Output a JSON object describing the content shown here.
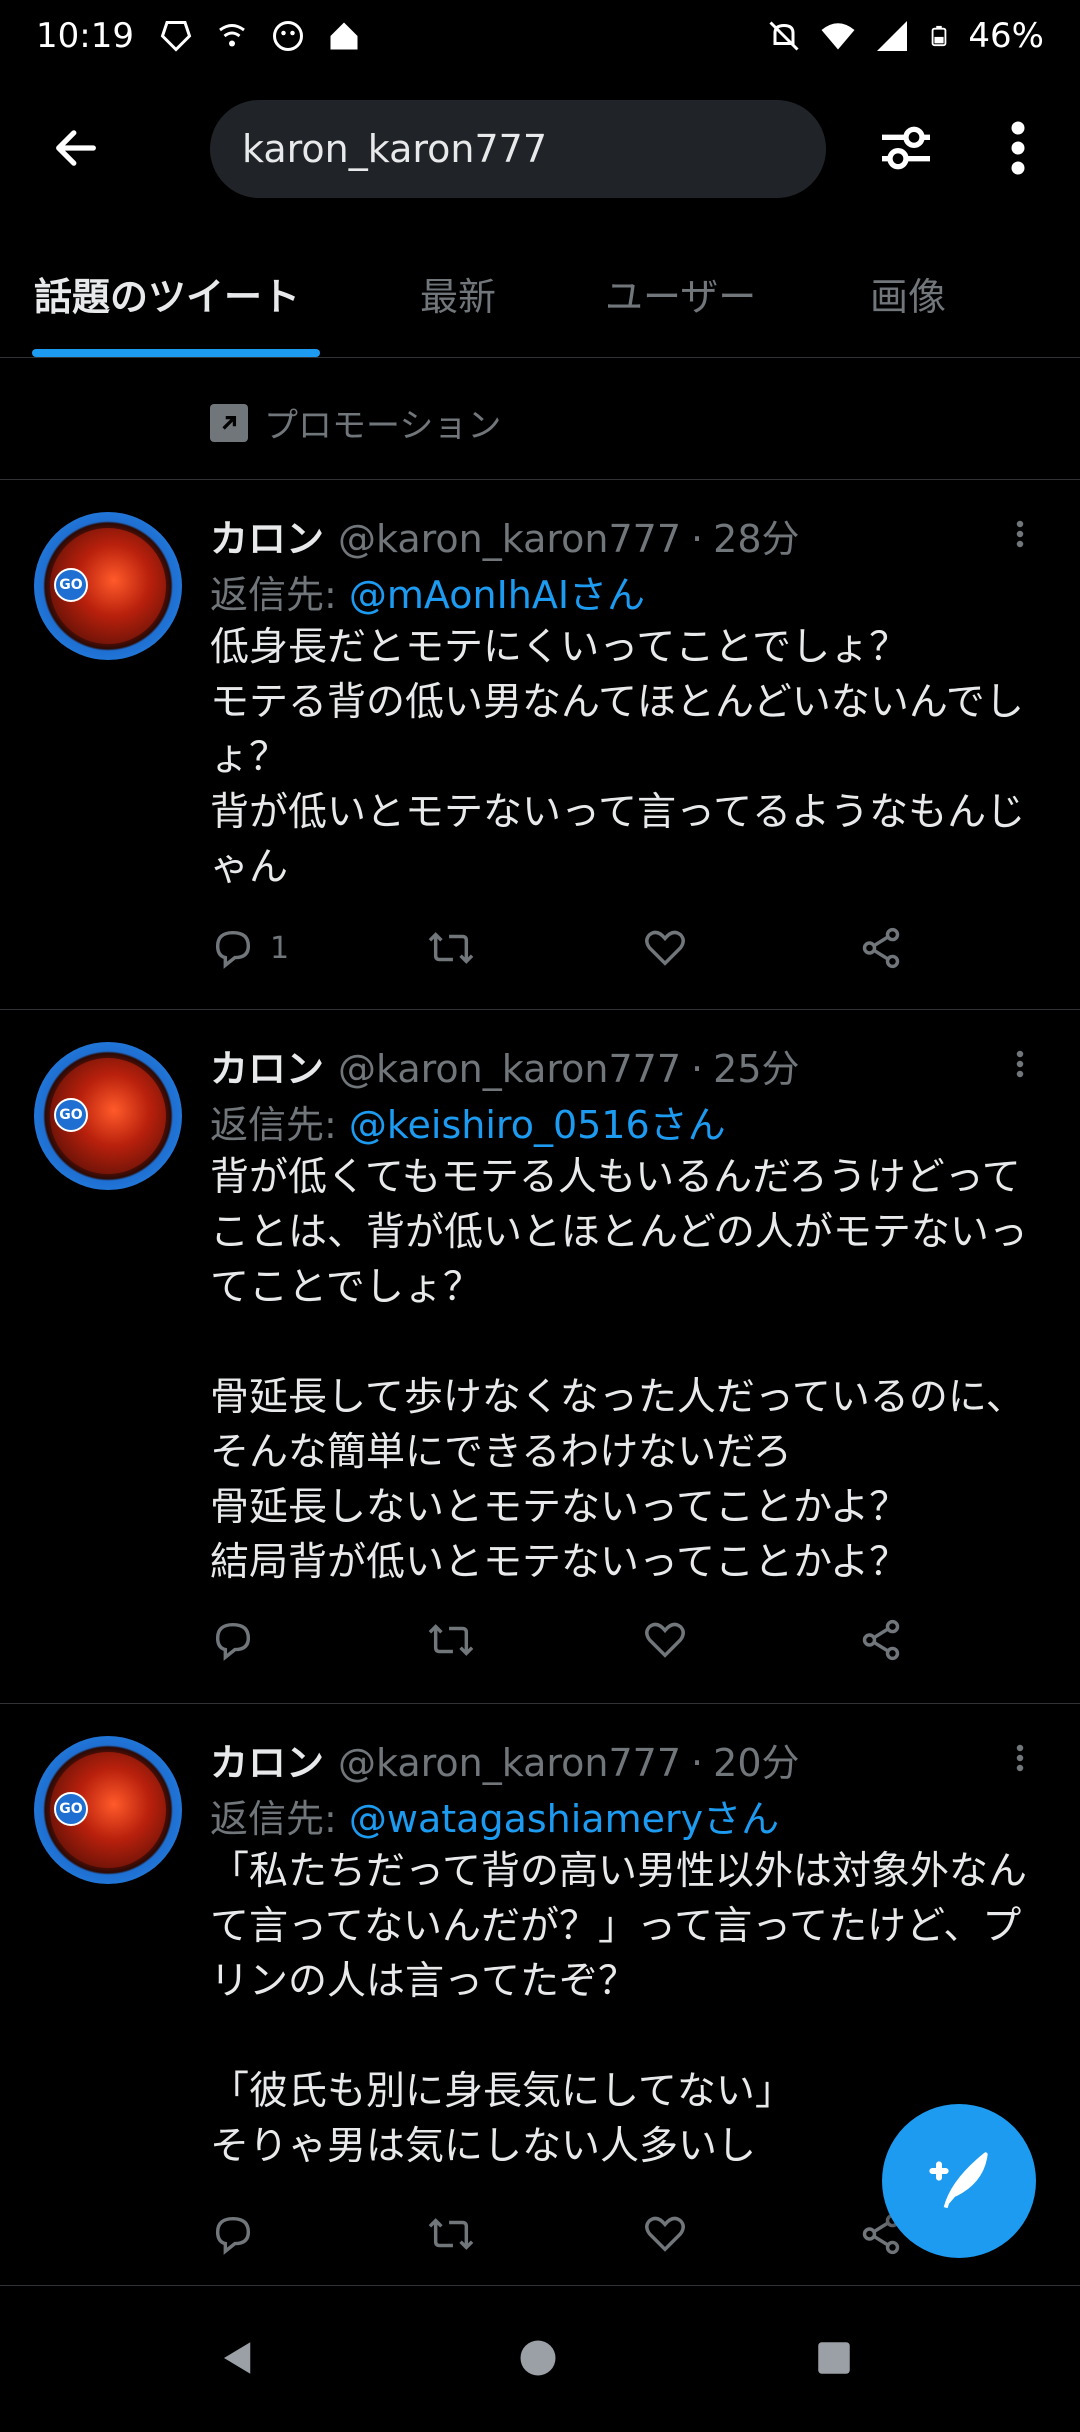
{
  "status_bar": {
    "time": "10:19",
    "battery": "46%",
    "left_icons": [
      "app-icon",
      "wifi-call-icon",
      "face-icon",
      "home-icon"
    ],
    "right_icons": [
      "mute-icon",
      "wifi-icon",
      "signal-icon",
      "battery-icon"
    ]
  },
  "header": {
    "search_value": "karon_karon777"
  },
  "tabs": [
    {
      "label": "話題のツイート",
      "active": true
    },
    {
      "label": "最新",
      "active": false
    },
    {
      "label": "ユーザー",
      "active": false
    },
    {
      "label": "画像",
      "active": false
    }
  ],
  "promo": {
    "label": "プロモーション"
  },
  "tweets": [
    {
      "name": "カロン",
      "handle": "@karon_karon777",
      "time": "28分",
      "reply_prefix": "返信先: ",
      "reply_to": "@mAonIhAIさん",
      "text": "低身長だとモテにくいってことでしょ？\nモテる背の低い男なんてほとんどいないんでしょ？\n背が低いとモテないって言ってるようなもんじゃん",
      "reply_count": "1"
    },
    {
      "name": "カロン",
      "handle": "@karon_karon777",
      "time": "25分",
      "reply_prefix": "返信先: ",
      "reply_to": "@keishiro_0516さん",
      "text": "背が低くてもモテる人もいるんだろうけどってことは、背が低いとほとんどの人がモテないってことでしょ？\n\n骨延長して歩けなくなった人だっているのに、そんな簡単にできるわけないだろ\n骨延長しないとモテないってことかよ？\n結局背が低いとモテないってことかよ？",
      "reply_count": ""
    },
    {
      "name": "カロン",
      "handle": "@karon_karon777",
      "time": "20分",
      "reply_prefix": "返信先: ",
      "reply_to": "@watagashiameryさん",
      "text": "「私たちだって背の高い男性以外は対象外なんて言ってないんだが？」って言ってたけど、プリンの人は言ってたぞ？\n\n「彼氏も別に身長気にしてない」\nそりゃ男は気にしない人多いし",
      "reply_count": ""
    }
  ],
  "colors": {
    "accent": "#1d9bf0",
    "background": "#000000",
    "muted": "#71767b",
    "text": "#e7e9ea"
  }
}
